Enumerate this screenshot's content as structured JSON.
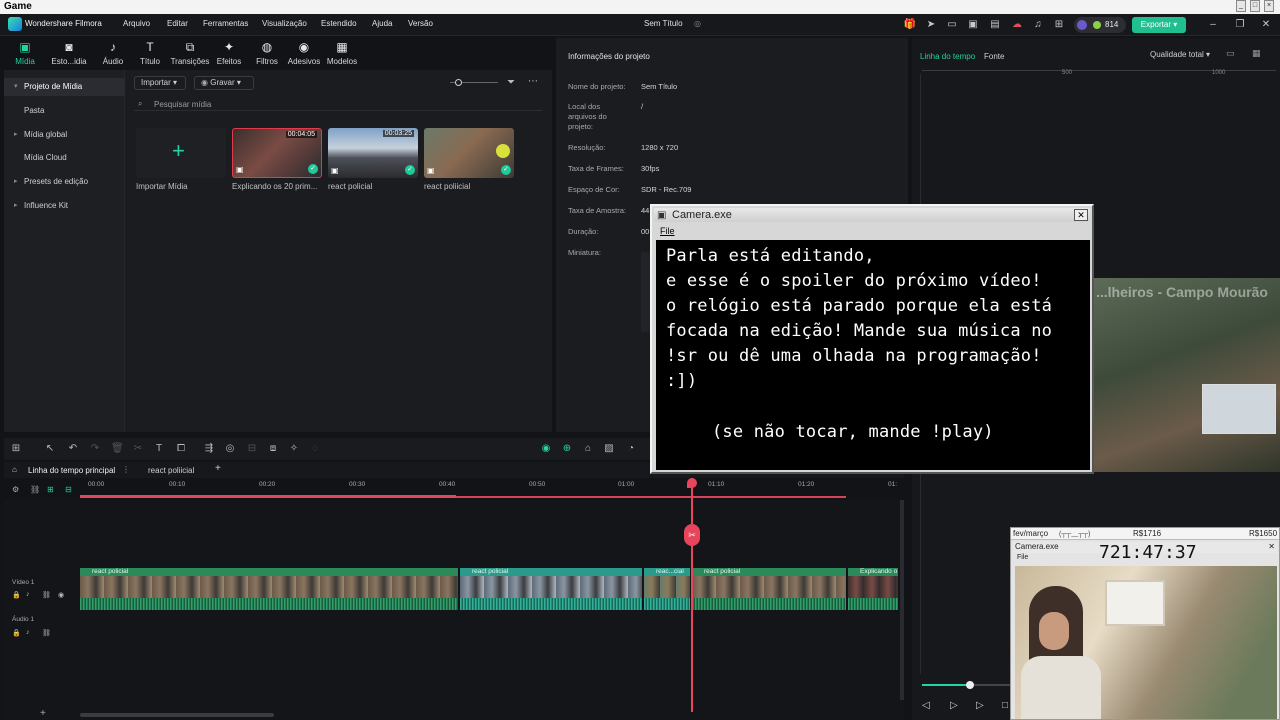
{
  "os": {
    "title": "Game"
  },
  "app": {
    "name": "Wondershare Filmora",
    "menu": [
      "Arquivo",
      "Editar",
      "Ferramentas",
      "Visualização",
      "Estendido",
      "Ajuda",
      "Versão"
    ],
    "project_title": "Sem Título",
    "coins": "814",
    "export_label": "Exportar"
  },
  "tools": [
    {
      "label": "Mídia",
      "icon": "media-icon"
    },
    {
      "label": "Esto...idia",
      "icon": "stock-icon"
    },
    {
      "label": "Áudio",
      "icon": "audio-icon"
    },
    {
      "label": "Título",
      "icon": "title-icon"
    },
    {
      "label": "Transições",
      "icon": "transitions-icon"
    },
    {
      "label": "Efeitos",
      "icon": "effects-icon"
    },
    {
      "label": "Filtros",
      "icon": "filters-icon"
    },
    {
      "label": "Adesivos",
      "icon": "stickers-icon"
    },
    {
      "label": "Modelos",
      "icon": "templates-icon"
    }
  ],
  "sidebar": {
    "items": [
      {
        "label": "Projeto de Mídia",
        "expand": "▾"
      },
      {
        "label": "Pasta",
        "expand": ""
      },
      {
        "label": "Mídia global",
        "expand": "▸"
      },
      {
        "label": "Mídia Cloud",
        "expand": ""
      },
      {
        "label": "Presets de edição",
        "expand": "▸"
      },
      {
        "label": "Influence Kit",
        "expand": "▸"
      }
    ]
  },
  "media": {
    "import_label": "Importar",
    "record_label": "Gravar",
    "search_placeholder": "Pesquisar mídia",
    "import_media_label": "Importar Mídia",
    "items": [
      {
        "label": "Explicando os 20 prim...",
        "duration": "00:04:05"
      },
      {
        "label": "react policial",
        "duration": "00:03:25"
      },
      {
        "label": "react poliicial",
        "duration": ""
      }
    ]
  },
  "info": {
    "header": "Informações do projeto",
    "rows": [
      {
        "k": "Nome do projeto:",
        "v": "Sem Título"
      },
      {
        "k": "Local dos arquivos do projeto:",
        "v": "/"
      },
      {
        "k": "Resolução:",
        "v": "1280 x 720"
      },
      {
        "k": "Taxa de Frames:",
        "v": "30fps"
      },
      {
        "k": "Espaço de Cor:",
        "v": "SDR - Rec.709"
      },
      {
        "k": "Taxa de Amostra:",
        "v": "44"
      },
      {
        "k": "Duração:",
        "v": "00"
      },
      {
        "k": "Miniatura:",
        "v": ""
      }
    ]
  },
  "preview": {
    "tab_timeline": "Linha do tempo",
    "tab_source": "Fonte",
    "quality": "Qualidade total",
    "ruler": [
      "500",
      "1000"
    ],
    "stream_banner": "...lheiros - Campo Mourão",
    "slider_level": 0.55
  },
  "timeline": {
    "tab_main": "Linha do tempo principal",
    "tab_second": "react poliicial",
    "ticks": [
      "00:00",
      "00:10",
      "00:20",
      "00:30",
      "00:40",
      "00:50",
      "01:00",
      "01:10",
      "01:20",
      "01:"
    ],
    "video_track": "Vídeo 1",
    "audio_track": "Áudio 1",
    "clips": [
      "react policial",
      "react policial",
      "reac...cial",
      "react policial",
      "Explicando o"
    ]
  },
  "camera": {
    "title": "Camera.exe",
    "menu": "File",
    "lines": [
      "Parla está editando,",
      "e esse é o spoiler do próximo vídeo!",
      "o relógio está parado porque ela está",
      "focada na edição! Mande sua música no",
      "!sr ou dê uma olhada na programação!",
      ":])",
      "(se não tocar, mande !play)"
    ]
  },
  "overlay": {
    "header_left": "fev/março",
    "header_emoji": "(┬┬﹏┬┬)",
    "goal1": "R$1716",
    "goal2": "R$1650",
    "title": "Camera.exe",
    "menu": "File",
    "clock": "721:47:37"
  }
}
